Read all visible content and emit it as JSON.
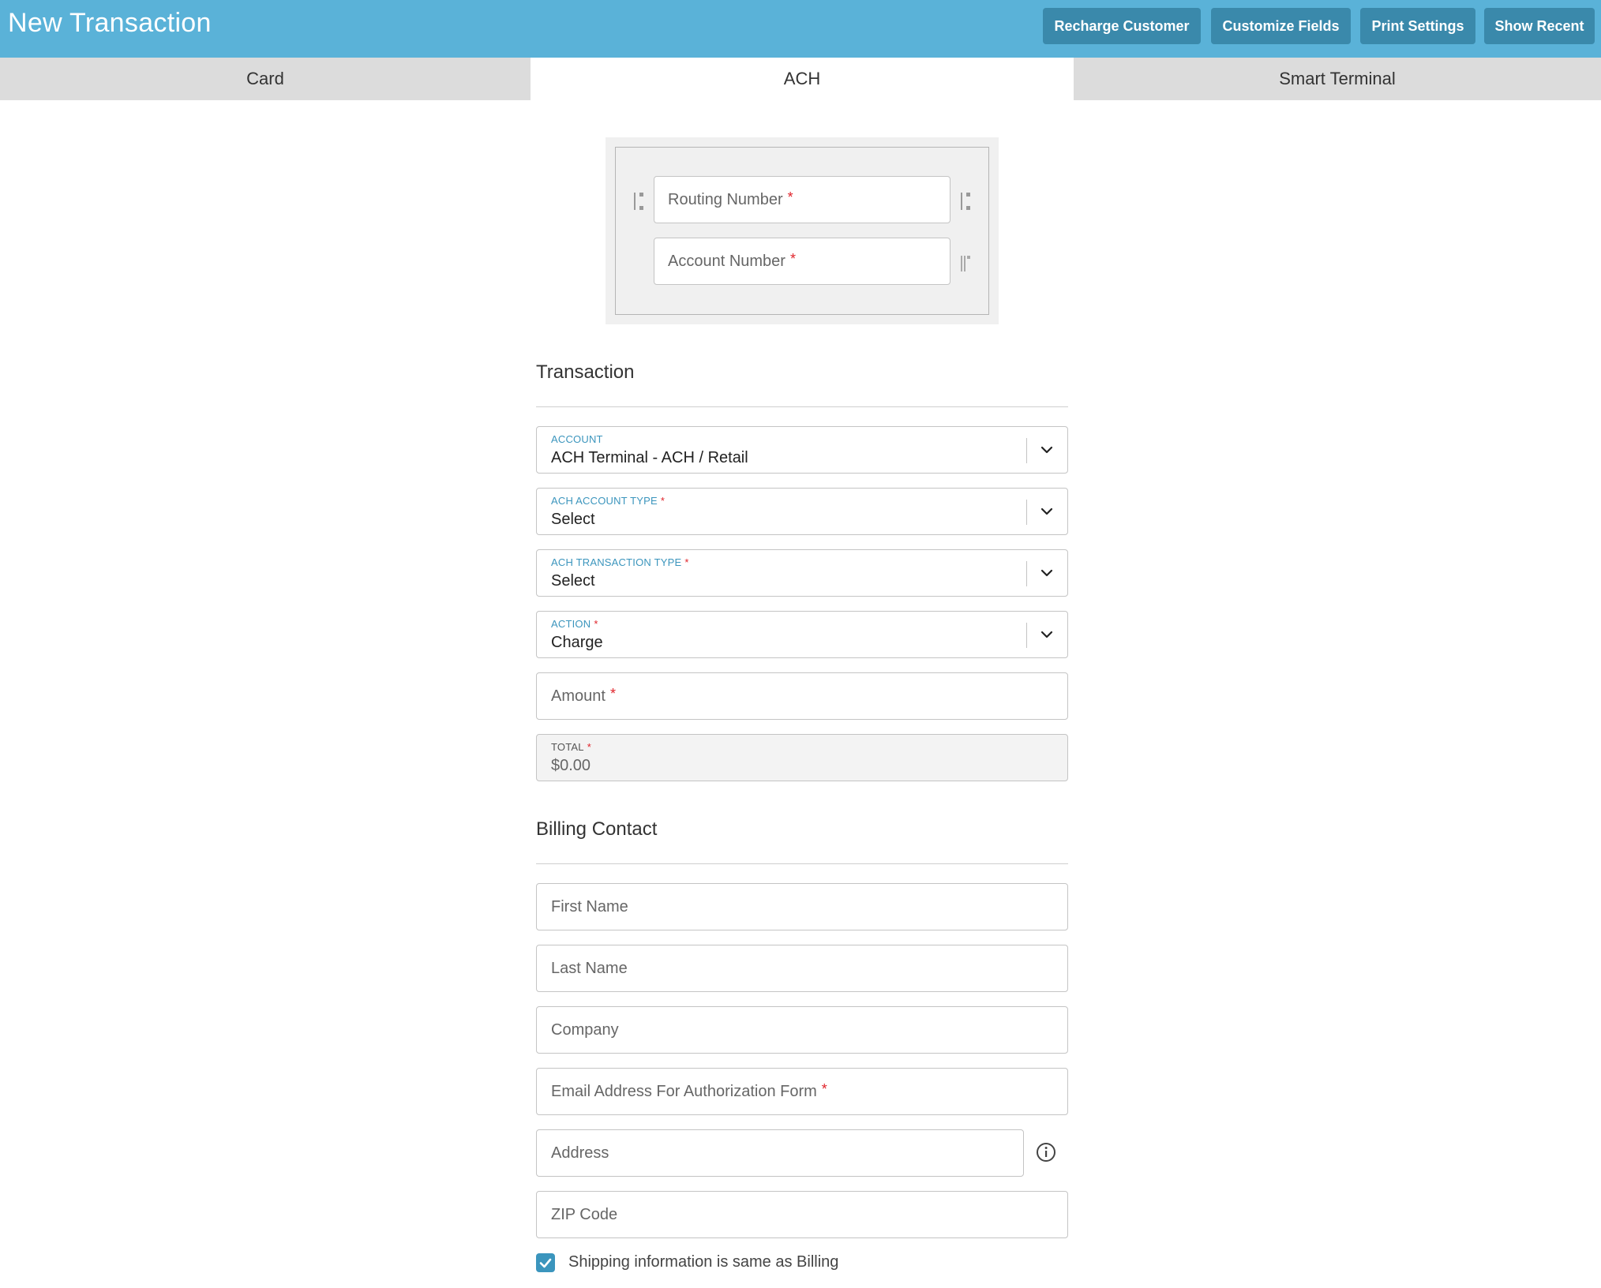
{
  "header": {
    "title": "New Transaction",
    "buttons": {
      "recharge": "Recharge Customer",
      "customize": "Customize Fields",
      "print": "Print Settings",
      "recent": "Show Recent"
    }
  },
  "tabs": [
    {
      "label": "Card",
      "active": false
    },
    {
      "label": "ACH",
      "active": true
    },
    {
      "label": "Smart Terminal",
      "active": false
    }
  ],
  "bank": {
    "routing_placeholder": "Routing Number",
    "account_placeholder": "Account Number",
    "required_mark": "*"
  },
  "transaction": {
    "section_title": "Transaction",
    "account": {
      "label": "ACCOUNT",
      "value": "ACH Terminal - ACH / Retail"
    },
    "ach_account_type": {
      "label": "ACH ACCOUNT TYPE",
      "value": "Select"
    },
    "ach_transaction_type": {
      "label": "ACH TRANSACTION TYPE",
      "value": "Select"
    },
    "action": {
      "label": "ACTION",
      "value": "Charge"
    },
    "amount": {
      "placeholder": "Amount"
    },
    "total": {
      "label": "TOTAL",
      "value": "$0.00"
    }
  },
  "billing": {
    "section_title": "Billing Contact",
    "first_name": "First Name",
    "last_name": "Last Name",
    "company": "Company",
    "email": "Email Address For Authorization Form",
    "address": "Address",
    "zip": "ZIP Code",
    "shipping_same_label": "Shipping information is same as Billing",
    "shipping_same_checked": true
  },
  "colors": {
    "header_bg": "#5ab2d8",
    "button_bg": "#3a89ab",
    "label_accent": "#3b95bd",
    "required": "#e0242b"
  }
}
